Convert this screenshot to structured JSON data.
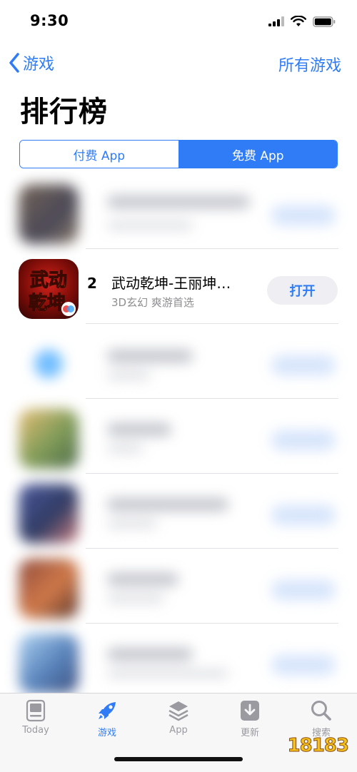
{
  "status_bar": {
    "time": "9:30"
  },
  "nav": {
    "back_label": "游戏",
    "right_link": "所有游戏"
  },
  "page_title": "排行榜",
  "segments": {
    "paid": "付费 App",
    "free": "免费 App",
    "selected": "free"
  },
  "list": {
    "featured": {
      "rank": "2",
      "name": "武动乾坤-王丽坤…",
      "subtitle": "3D玄幻 爽游首选",
      "button": "打开",
      "icon_text_top": "武动",
      "icon_text_bottom": "乾坤"
    }
  },
  "tab_bar": {
    "items": [
      {
        "label": "Today",
        "icon": "today-icon",
        "active": false
      },
      {
        "label": "游戏",
        "icon": "rocket-icon",
        "active": true
      },
      {
        "label": "App",
        "icon": "layers-icon",
        "active": false
      },
      {
        "label": "更新",
        "icon": "download-icon",
        "active": false
      },
      {
        "label": "搜索",
        "icon": "search-icon",
        "active": false
      }
    ]
  },
  "watermark": "18183",
  "colors": {
    "accent": "#2f7cf6",
    "segment_border": "#2f7cf6",
    "button_bg": "#eeeef3"
  }
}
